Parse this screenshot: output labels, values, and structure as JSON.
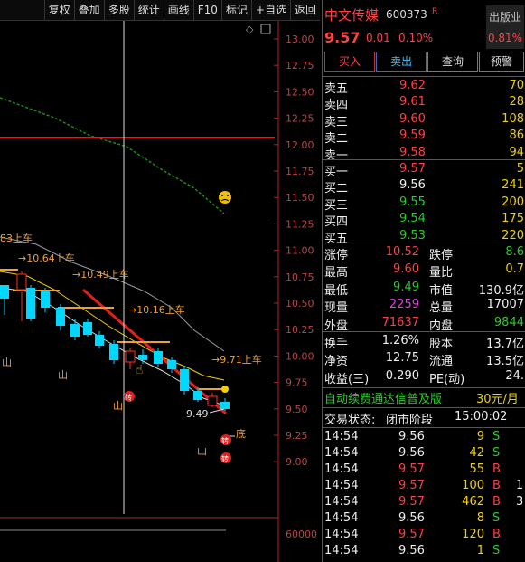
{
  "toolbar": {
    "items": [
      "复权",
      "叠加",
      "多股",
      "统计",
      "画线",
      "F10",
      "标记",
      "+自选",
      "返回"
    ]
  },
  "chart": {
    "y_ticks": [
      "13.00",
      "12.75",
      "12.50",
      "12.25",
      "12.00",
      "11.75",
      "11.50",
      "11.25",
      "11.00",
      "10.75",
      "10.50",
      "10.25",
      "10.00",
      "9.75",
      "9.50",
      "9.25",
      "9.00"
    ],
    "vol_tick": "60000",
    "labels": {
      "l1": "83上车",
      "l2": "→10.64上车",
      "l3": "→10.49上车",
      "l4": "→10.16上车",
      "l5": "→9.71上车",
      "low_price": "9.49",
      "bottom": "底",
      "mountain": "山",
      "limit_icon": "转"
    },
    "colors": {
      "up": "#ff3030",
      "down": "#00d8ff",
      "ma_yellow": "#f0d000",
      "ma_gray": "#9a9a9a",
      "trend": "#e02020",
      "ma_green": "#1a8a1a"
    }
  },
  "stock": {
    "name": "中文传媒",
    "code": "600373",
    "r_badge": "R",
    "industry_l1": "出版业",
    "industry_l2": "0.81%",
    "price": "9.57",
    "change": "0.01",
    "change_pct": "0.10%"
  },
  "buttons": {
    "buy": "买入",
    "sell": "卖出",
    "query": "查询",
    "alert": "预警"
  },
  "orderbook": {
    "asks": [
      {
        "label": "卖五",
        "price": "9.62",
        "vol": "70"
      },
      {
        "label": "卖四",
        "price": "9.61",
        "vol": "28"
      },
      {
        "label": "卖三",
        "price": "9.60",
        "vol": "108"
      },
      {
        "label": "卖二",
        "price": "9.59",
        "vol": "86"
      },
      {
        "label": "卖一",
        "price": "9.58",
        "vol": "94"
      }
    ],
    "bids": [
      {
        "label": "买一",
        "price": "9.57",
        "vol": "5"
      },
      {
        "label": "买二",
        "price": "9.56",
        "vol": "241"
      },
      {
        "label": "买三",
        "price": "9.55",
        "vol": "200"
      },
      {
        "label": "买四",
        "price": "9.54",
        "vol": "175"
      },
      {
        "label": "买五",
        "price": "9.53",
        "vol": "220"
      }
    ]
  },
  "stats": [
    {
      "k1": "涨停",
      "v1": "10.52",
      "k2": "跌停",
      "v2": "8.6"
    },
    {
      "k1": "最高",
      "v1": "9.60",
      "k2": "量比",
      "v2": "0.7"
    },
    {
      "k1": "最低",
      "v1": "9.49",
      "k2": "市值",
      "v2": "130.9亿"
    },
    {
      "k1": "现量",
      "v1": "2259",
      "k2": "总量",
      "v2": "17007"
    },
    {
      "k1": "外盘",
      "v1": "71637",
      "k2": "内盘",
      "v2": "9844"
    }
  ],
  "stats2": [
    {
      "k1": "换手",
      "v1": "1.26%",
      "k2": "股本",
      "v2": "13.7亿"
    },
    {
      "k1": "净资",
      "v1": "12.75",
      "k2": "流通",
      "v2": "13.5亿"
    },
    {
      "k1": "收益(三)",
      "v1": "0.290",
      "k2": "PE(动)",
      "v2": "24."
    }
  ],
  "promo": {
    "text": "自动续费通达信普及版",
    "price": "30元/月"
  },
  "trade_status": {
    "label": "交易状态:",
    "value": "闭市阶段",
    "time": "15:00:02"
  },
  "ticks": [
    {
      "t": "14:54",
      "p": "9.56",
      "v": "9",
      "s": "S",
      "n": ""
    },
    {
      "t": "14:54",
      "p": "9.56",
      "v": "42",
      "s": "S",
      "n": ""
    },
    {
      "t": "14:54",
      "p": "9.57",
      "v": "55",
      "s": "B",
      "n": ""
    },
    {
      "t": "14:54",
      "p": "9.57",
      "v": "100",
      "s": "B",
      "n": "1"
    },
    {
      "t": "14:54",
      "p": "9.57",
      "v": "462",
      "s": "B",
      "n": "3"
    },
    {
      "t": "14:54",
      "p": "9.56",
      "v": "8",
      "s": "S",
      "n": ""
    },
    {
      "t": "14:54",
      "p": "9.57",
      "v": "120",
      "s": "B",
      "n": ""
    },
    {
      "t": "14:54",
      "p": "9.56",
      "v": "1",
      "s": "S",
      "n": ""
    }
  ]
}
